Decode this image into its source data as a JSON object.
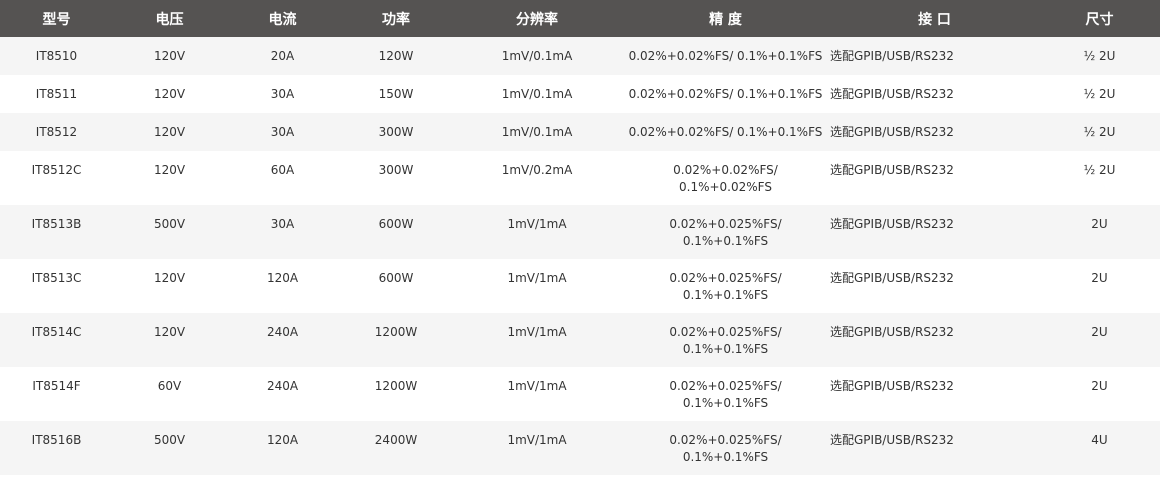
{
  "table": {
    "headers": [
      "型号",
      "电压",
      "电流",
      "功率",
      "分辨率",
      "精 度",
      "接 口",
      "尺寸"
    ],
    "rows": [
      {
        "model": "IT8510",
        "voltage": "120V",
        "current": "20A",
        "power": "120W",
        "resolution": "1mV/0.1mA",
        "precision": [
          "0.02%+0.02%FS/ 0.1%+0.1%FS"
        ],
        "interface": "选配GPIB/USB/RS232",
        "size": "½ 2U"
      },
      {
        "model": "IT8511",
        "voltage": "120V",
        "current": "30A",
        "power": "150W",
        "resolution": "1mV/0.1mA",
        "precision": [
          "0.02%+0.02%FS/ 0.1%+0.1%FS"
        ],
        "interface": "选配GPIB/USB/RS232",
        "size": "½ 2U"
      },
      {
        "model": "IT8512",
        "voltage": "120V",
        "current": "30A",
        "power": "300W",
        "resolution": "1mV/0.1mA",
        "precision": [
          "0.02%+0.02%FS/ 0.1%+0.1%FS"
        ],
        "interface": "选配GPIB/USB/RS232",
        "size": "½ 2U"
      },
      {
        "model": "IT8512C",
        "voltage": "120V",
        "current": "60A",
        "power": "300W",
        "resolution": "1mV/0.2mA",
        "precision": [
          "0.02%+0.02%FS/",
          "0.1%+0.02%FS"
        ],
        "interface": "选配GPIB/USB/RS232",
        "size": "½ 2U"
      },
      {
        "model": "IT8513B",
        "voltage": "500V",
        "current": "30A",
        "power": "600W",
        "resolution": "1mV/1mA",
        "precision": [
          "0.02%+0.025%FS/",
          "0.1%+0.1%FS"
        ],
        "interface": "选配GPIB/USB/RS232",
        "size": "2U"
      },
      {
        "model": "IT8513C",
        "voltage": "120V",
        "current": "120A",
        "power": "600W",
        "resolution": "1mV/1mA",
        "precision": [
          "0.02%+0.025%FS/",
          "0.1%+0.1%FS"
        ],
        "interface": "选配GPIB/USB/RS232",
        "size": "2U"
      },
      {
        "model": "IT8514C",
        "voltage": "120V",
        "current": "240A",
        "power": "1200W",
        "resolution": "1mV/1mA",
        "precision": [
          "0.02%+0.025%FS/",
          "0.1%+0.1%FS"
        ],
        "interface": "选配GPIB/USB/RS232",
        "size": "2U"
      },
      {
        "model": "IT8514F",
        "voltage": "60V",
        "current": "240A",
        "power": "1200W",
        "resolution": "1mV/1mA",
        "precision": [
          "0.02%+0.025%FS/",
          "0.1%+0.1%FS"
        ],
        "interface": "选配GPIB/USB/RS232",
        "size": "2U"
      },
      {
        "model": "IT8516B",
        "voltage": "500V",
        "current": "120A",
        "power": "2400W",
        "resolution": "1mV/1mA",
        "precision": [
          "0.02%+0.025%FS/",
          "0.1%+0.1%FS"
        ],
        "interface": "选配GPIB/USB/RS232",
        "size": "4U"
      }
    ]
  }
}
